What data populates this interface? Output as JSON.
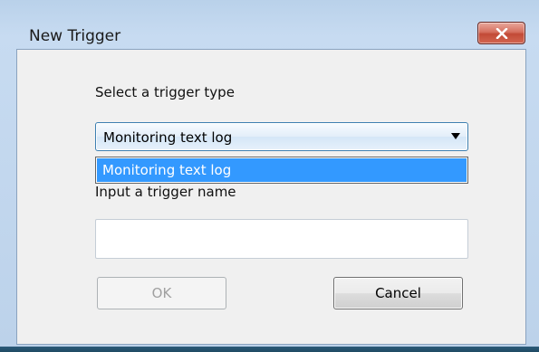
{
  "window": {
    "title": "New Trigger"
  },
  "form": {
    "type_label": "Select a trigger type",
    "type_selected": "Monitoring text log",
    "type_options": [
      "Monitoring text log"
    ],
    "name_label": "Input a trigger name",
    "name_value": ""
  },
  "buttons": {
    "ok": "OK",
    "cancel": "Cancel"
  },
  "icons": {
    "close": "close-icon",
    "dropdown": "chevron-down-icon"
  },
  "colors": {
    "selection": "#3399ff",
    "close_button": "#c24a36"
  }
}
